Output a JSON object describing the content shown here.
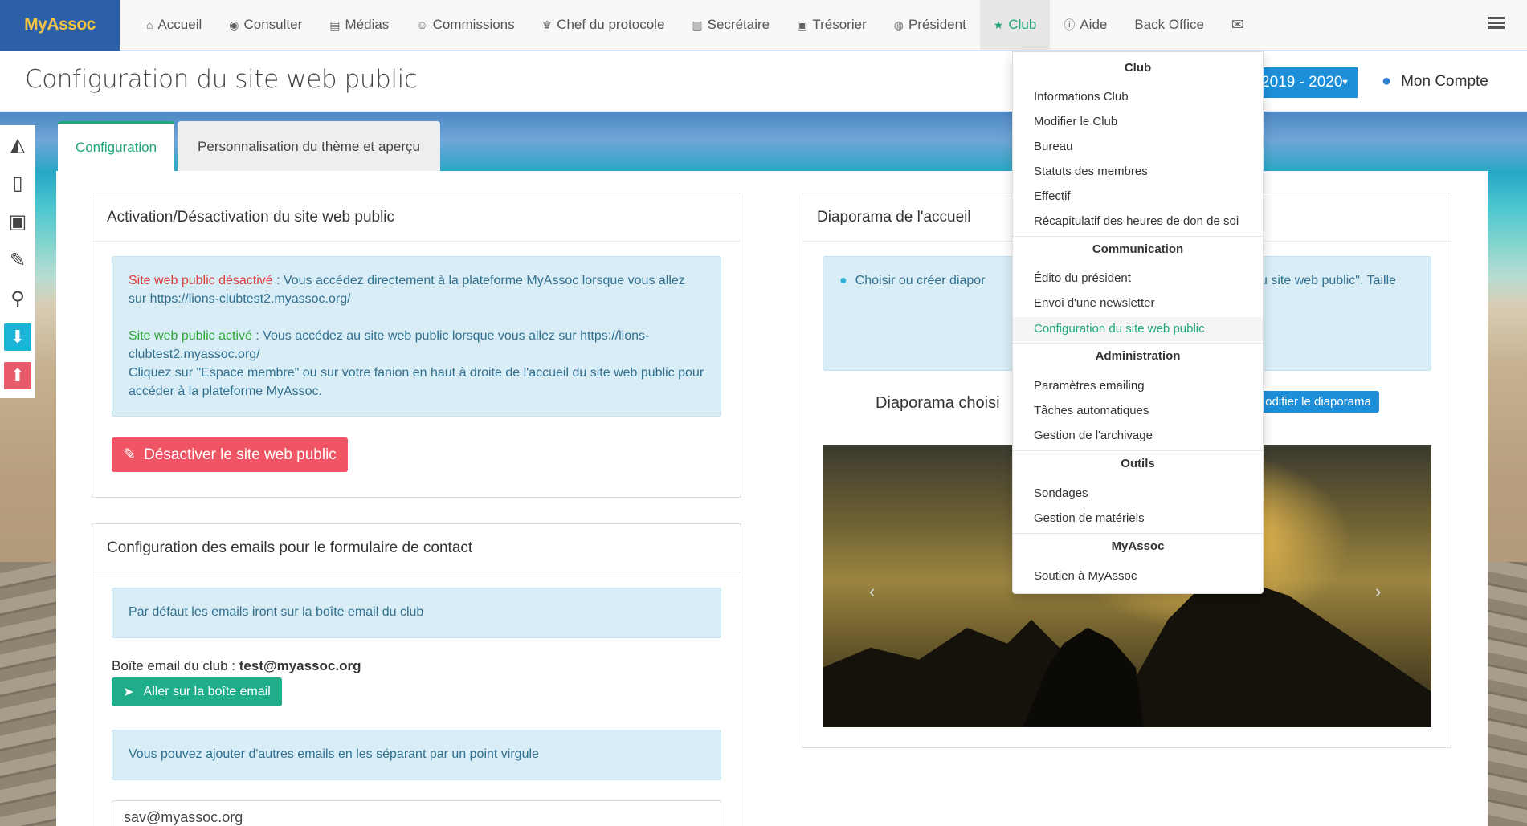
{
  "brand": "MyAssoc",
  "nav": {
    "items": [
      {
        "label": "Accueil",
        "icon": "home-icon",
        "glyph": "⌂"
      },
      {
        "label": "Consulter",
        "icon": "eye-icon",
        "glyph": "◉"
      },
      {
        "label": "Médias",
        "icon": "file-icon",
        "glyph": "▤"
      },
      {
        "label": "Commissions",
        "icon": "users-icon",
        "glyph": "☺"
      },
      {
        "label": "Chef du protocole",
        "icon": "trophy-icon",
        "glyph": "♛"
      },
      {
        "label": "Secrétaire",
        "icon": "book-icon",
        "glyph": "▥"
      },
      {
        "label": "Trésorier",
        "icon": "money-icon",
        "glyph": "▣"
      },
      {
        "label": "Président",
        "icon": "globe-icon",
        "glyph": "◍"
      },
      {
        "label": "Club",
        "icon": "star-icon",
        "glyph": "★"
      },
      {
        "label": "Aide",
        "icon": "info-icon",
        "glyph": "ⓘ"
      },
      {
        "label": "Back Office",
        "icon": "",
        "glyph": ""
      },
      {
        "label": "",
        "icon": "envelope-icon",
        "glyph": "✉"
      }
    ]
  },
  "header": {
    "title": "Configuration du site web public",
    "year": "2019 - 2020",
    "account": "Mon Compte"
  },
  "tabs": {
    "config": "Configuration",
    "theme": "Personnalisation du thème et aperçu"
  },
  "activation": {
    "title": "Activation/Désactivation du site web public",
    "off_label": "Site web public désactivé",
    "off_text": " : Vous accédez directement à la plateforme MyAssoc lorsque vous allez sur https://lions-clubtest2.myassoc.org/",
    "on_label": "Site web public activé",
    "on_text": " : Vous accédez au site web public lorsque vous allez sur https://lions-clubtest2.myassoc.org/",
    "on_text2": "Cliquez sur \"Espace membre\" ou sur votre fanion en haut à droite de l'accueil du site web public pour accéder à la plateforme MyAssoc.",
    "button": "Désactiver le site web public"
  },
  "emails": {
    "title": "Configuration des emails pour le formulaire de contact",
    "default_note": "Par défaut les emails iront sur la boîte email du club",
    "club_label": "Boîte email du club : ",
    "club_email": "test@myassoc.org",
    "button": "Aller sur la boîte email",
    "add_note": "Vous pouvez ajouter d'autres emails en les séparant par un point virgule",
    "input_value": "sav@myassoc.org"
  },
  "slideshow": {
    "title": "Diaporama de l'accueil",
    "info_left": "Choisir ou créer diapor",
    "info_right": "u site web public\". Taille",
    "chosen_label": "Diaporama choisi",
    "button": "odifier le diaporama",
    "prev": "‹",
    "next": "›"
  },
  "menu": {
    "sections": [
      {
        "title": "Club",
        "items": [
          "Informations Club",
          "Modifier le Club",
          "Bureau",
          "Statuts des membres",
          "Effectif",
          "Récapitulatif des heures de don de soi"
        ]
      },
      {
        "title": "Communication",
        "items": [
          "Édito du président",
          "Envoi d'une newsletter",
          "Configuration du site web public"
        ]
      },
      {
        "title": "Administration",
        "items": [
          "Paramètres emailing",
          "Tâches automatiques",
          "Gestion de l'archivage"
        ]
      },
      {
        "title": "Outils",
        "items": [
          "Sondages",
          "Gestion de matériels"
        ]
      },
      {
        "title": "MyAssoc",
        "items": [
          "Soutien à MyAssoc"
        ]
      }
    ]
  },
  "colors": {
    "brand_bg": "#2b5fa8",
    "brand_text": "#f5c342",
    "accent_green": "#1fa67a",
    "danger": "#ef5564",
    "primary": "#1d8fd8",
    "info_bg": "#d9edf7"
  }
}
